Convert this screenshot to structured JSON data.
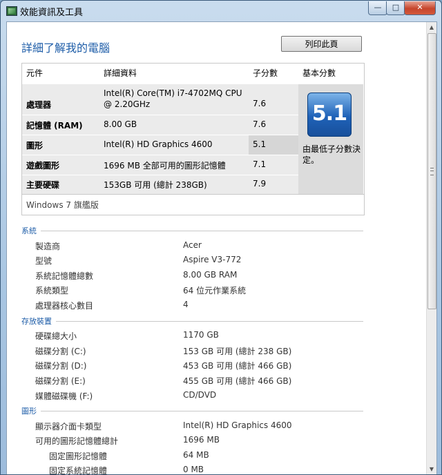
{
  "window": {
    "title": "效能資訊及工具",
    "minimize": "—",
    "maximize": "□",
    "close": "✕"
  },
  "header": {
    "title": "詳細了解我的電腦",
    "print_button": "列印此頁"
  },
  "score_table": {
    "columns": [
      "元件",
      "詳細資料",
      "子分數",
      "基本分數"
    ],
    "rows": [
      {
        "component": "處理器",
        "detail_line1": "Intel(R) Core(TM) i7-4702MQ CPU",
        "detail_line2": "@ 2.20GHz",
        "score": "7.6"
      },
      {
        "component": "記憶體 (RAM)",
        "detail": "8.00 GB",
        "score": "7.6"
      },
      {
        "component": "圖形",
        "detail": "Intel(R) HD Graphics 4600",
        "score": "5.1"
      },
      {
        "component": "遊戲圖形",
        "detail": "1696 MB 全部可用的圖形記憶體",
        "score": "7.1"
      },
      {
        "component": "主要硬碟",
        "detail": "153GB 可用 (總計 238GB)",
        "score": "7.9"
      }
    ],
    "base_score": "5.1",
    "base_note": "由最低子分數決定。",
    "os_edition": "Windows 7 旗艦版"
  },
  "sections": {
    "system": {
      "label": "系統",
      "items": [
        {
          "key": "製造商",
          "value": "Acer"
        },
        {
          "key": "型號",
          "value": "Aspire V3-772"
        },
        {
          "key": "系統記憶體總數",
          "value": "8.00 GB RAM"
        },
        {
          "key": "系統類型",
          "value": "64 位元作業系統"
        },
        {
          "key": "處理器核心數目",
          "value": "4"
        }
      ]
    },
    "storage": {
      "label": "存放裝置",
      "items": [
        {
          "key": "硬碟總大小",
          "value": "1170 GB"
        },
        {
          "key": "磁碟分割 (C:)",
          "value": "153 GB 可用 (總計 238 GB)"
        },
        {
          "key": "磁碟分割 (D:)",
          "value": "453 GB 可用 (總計 466 GB)"
        },
        {
          "key": "磁碟分割 (E:)",
          "value": "455 GB 可用 (總計 466 GB)"
        },
        {
          "key": "媒體磁碟機 (F:)",
          "value": "CD/DVD"
        }
      ]
    },
    "graphics": {
      "label": "圖形",
      "items": [
        {
          "key": "顯示器介面卡類型",
          "value": "Intel(R) HD Graphics 4600"
        },
        {
          "key": "可用的圖形記憶體總計",
          "value": "1696 MB"
        },
        {
          "key": "固定圖形記憶體",
          "value": "64 MB"
        },
        {
          "key": "固定系統記憶體",
          "value": "0 MB"
        }
      ]
    }
  },
  "scrollbar": {
    "up_arrow": "▲",
    "down_arrow": "▼"
  }
}
